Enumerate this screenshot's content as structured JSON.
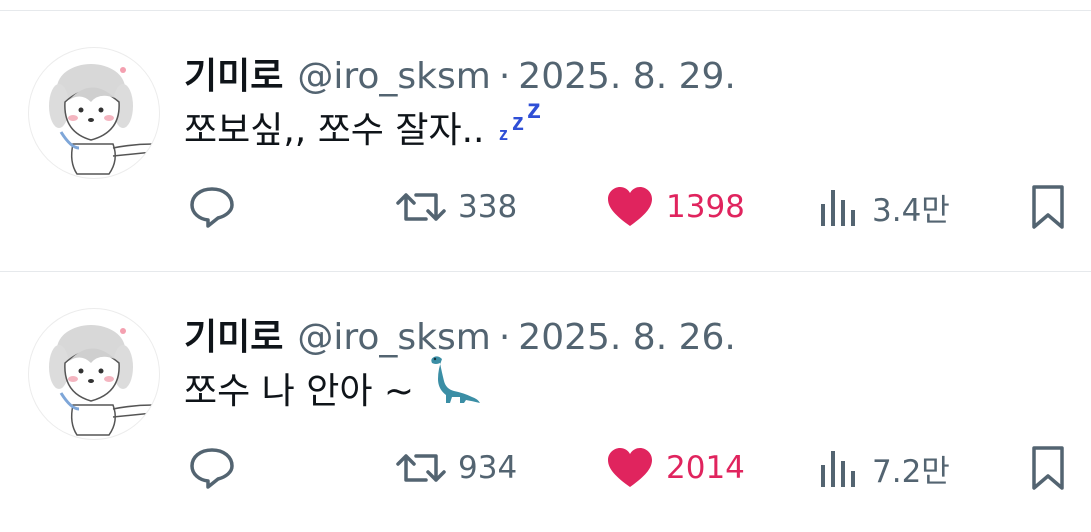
{
  "tweets": [
    {
      "name": "기미로",
      "handle": "@iro_sksm",
      "separator": "·",
      "date": "2025. 8. 29.",
      "text": "쪼보싶,, 쪼수 잘자..",
      "emoji": "zzz-sleep",
      "replies": "",
      "retweets": "338",
      "likes": "1398",
      "views": "3.4만"
    },
    {
      "name": "기미로",
      "handle": "@iro_sksm",
      "separator": "·",
      "date": "2025. 8. 26.",
      "text": "쪼수 나 안아 ~",
      "emoji": "sauropod",
      "replies": "",
      "retweets": "934",
      "likes": "2014",
      "views": "7.2만"
    }
  ],
  "colors": {
    "like": "#e0245e",
    "secondary_text": "#536471",
    "primary_text": "#0f1419",
    "divider": "#e6e9ec",
    "zzz": "#2f4fd6",
    "dino": "#3b8ea5"
  }
}
